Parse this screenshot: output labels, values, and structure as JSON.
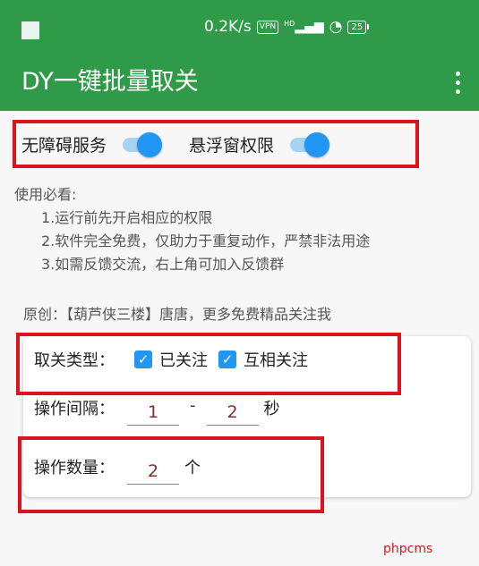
{
  "status_bar": {
    "speed": "0.2K/s",
    "vpn": "VPN",
    "signal": "HD",
    "battery": "25"
  },
  "app_bar": {
    "title": "DY一键批量取关"
  },
  "permissions": {
    "accessibility_label": "无障碍服务",
    "accessibility_on": true,
    "overlay_label": "悬浮窗权限",
    "overlay_on": true
  },
  "notes": {
    "heading": "使用必看:",
    "items": [
      "1.运行前先开启相应的权限",
      "2.软件完全免费，仅助力于重复动作，严禁非法用途",
      "3.如需反馈交流，右上角可加入反馈群"
    ]
  },
  "credit": "原创：【葫芦侠三楼】唐唐，更多免费精品关注我",
  "settings": {
    "type_label": "取关类型：",
    "option_followed": "已关注",
    "option_followed_checked": true,
    "option_mutual": "互相关注",
    "option_mutual_checked": true,
    "interval_label": "操作间隔：",
    "interval_min": "1",
    "interval_sep": "-",
    "interval_max": "2",
    "interval_unit": "秒",
    "count_label": "操作数量：",
    "count_value": "2",
    "count_unit": "个"
  },
  "watermark": "phpcms",
  "colors": {
    "app_bar": "#2f9a48",
    "accent": "#2196f3",
    "highlight_box": "#d9141e"
  }
}
